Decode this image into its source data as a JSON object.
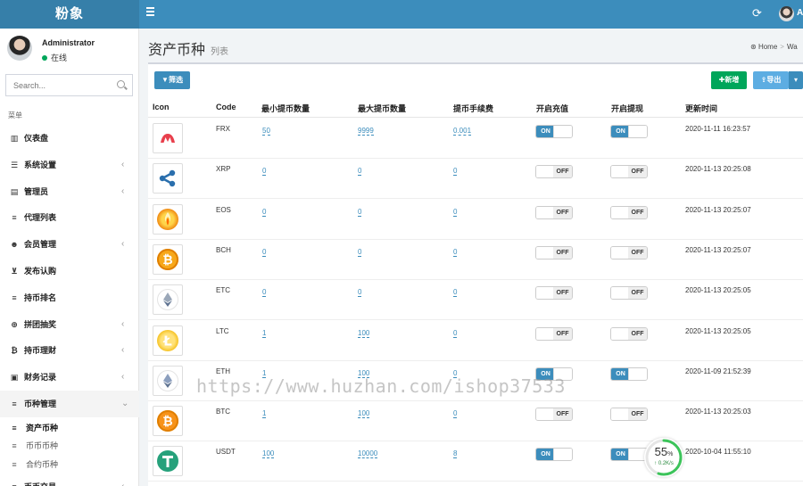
{
  "header": {
    "logo": "粉象",
    "user_short": "A",
    "refresh_icon": "refresh-icon"
  },
  "user": {
    "name": "Administrator",
    "status": "在线"
  },
  "search": {
    "placeholder": "Search..."
  },
  "sidebar": {
    "menu_header": "菜单",
    "items": [
      {
        "label": "仪表盘",
        "icon": "dashboard-icon",
        "chevron": false
      },
      {
        "label": "系统设置",
        "icon": "sliders-icon",
        "chevron": true
      },
      {
        "label": "管理员",
        "icon": "users-card-icon",
        "chevron": true
      },
      {
        "label": "代理列表",
        "icon": "list-icon",
        "chevron": false
      },
      {
        "label": "会员管理",
        "icon": "users-icon",
        "chevron": true
      },
      {
        "label": "发布认购",
        "icon": "cart-icon",
        "chevron": false
      },
      {
        "label": "持币排名",
        "icon": "list-icon",
        "chevron": false
      },
      {
        "label": "拼团抽奖",
        "icon": "gamepad-icon",
        "chevron": true
      },
      {
        "label": "持币理财",
        "icon": "bitcoin-icon",
        "chevron": true
      },
      {
        "label": "财务记录",
        "icon": "money-icon",
        "chevron": true
      },
      {
        "label": "币种管理",
        "icon": "list-icon",
        "chevron": true,
        "expanded": true
      },
      {
        "label": "币币交易",
        "icon": "list-icon",
        "chevron": true
      }
    ],
    "subitems": [
      {
        "label": "资产币种",
        "current": true
      },
      {
        "label": "币币币种",
        "current": false
      },
      {
        "label": "合约币种",
        "current": false
      }
    ]
  },
  "page": {
    "title": "资产币种",
    "subtitle": "列表"
  },
  "breadcrumb": {
    "home": "Home",
    "next": "Wa"
  },
  "toolbar": {
    "filter": "筛选",
    "add": "新增",
    "export": "导出"
  },
  "table": {
    "headers": [
      "Icon",
      "Code",
      "最小提币数量",
      "最大提币数量",
      "提币手续费",
      "开启充值",
      "开启提现",
      "更新时间"
    ],
    "on_label": "ON",
    "off_label": "OFF",
    "rows": [
      {
        "code": "FRX",
        "min": "50",
        "max": "9999",
        "fee": "0.001",
        "deposit": true,
        "withdraw": true,
        "updated": "2020-11-11 16:23:57",
        "icon": "frx-coin-icon",
        "color": "#e8404d"
      },
      {
        "code": "XRP",
        "min": "0",
        "max": "0",
        "fee": "0",
        "deposit": false,
        "withdraw": false,
        "updated": "2020-11-13 20:25:08",
        "icon": "xrp-coin-icon",
        "color": "#2a6fad"
      },
      {
        "code": "EOS",
        "min": "0",
        "max": "0",
        "fee": "0",
        "deposit": false,
        "withdraw": false,
        "updated": "2020-11-13 20:25:07",
        "icon": "eos-coin-icon",
        "color": "#f5a623"
      },
      {
        "code": "BCH",
        "min": "0",
        "max": "0",
        "fee": "0",
        "deposit": false,
        "withdraw": false,
        "updated": "2020-11-13 20:25:07",
        "icon": "bch-coin-icon",
        "color": "#f7a81b"
      },
      {
        "code": "ETC",
        "min": "0",
        "max": "0",
        "fee": "0",
        "deposit": false,
        "withdraw": false,
        "updated": "2020-11-13 20:25:05",
        "icon": "etc-coin-icon",
        "color": "#9aa7b8"
      },
      {
        "code": "LTC",
        "min": "1",
        "max": "100",
        "fee": "0",
        "deposit": false,
        "withdraw": false,
        "updated": "2020-11-13 20:25:05",
        "icon": "ltc-coin-icon",
        "color": "#f2c21a"
      },
      {
        "code": "ETH",
        "min": "1",
        "max": "100",
        "fee": "0",
        "deposit": true,
        "withdraw": true,
        "updated": "2020-11-09 21:52:39",
        "icon": "eth-coin-icon",
        "color": "#8c9fbe"
      },
      {
        "code": "BTC",
        "min": "1",
        "max": "100",
        "fee": "0",
        "deposit": false,
        "withdraw": false,
        "updated": "2020-11-13 20:25:03",
        "icon": "btc-coin-icon",
        "color": "#f7931a"
      },
      {
        "code": "USDT",
        "min": "100",
        "max": "10000",
        "fee": "8",
        "deposit": true,
        "withdraw": true,
        "updated": "2020-10-04 11:55:10",
        "icon": "usdt-coin-icon",
        "color": "#26a17b"
      }
    ]
  },
  "watermark": "https://www.huzhan.com/ishop37533",
  "widget": {
    "percent": "55",
    "percent_unit": "%",
    "speed": "0.2K/s",
    "fill": 0.55
  }
}
